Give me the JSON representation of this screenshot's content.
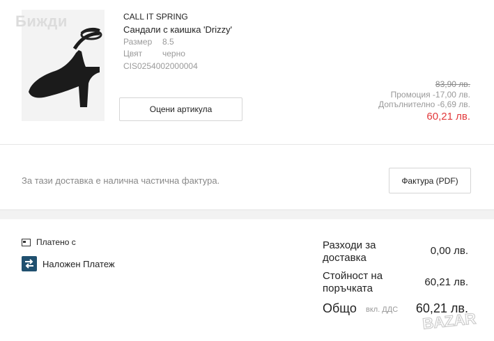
{
  "watermark": "Бижди",
  "item": {
    "brand": "CALL IT SPRING",
    "name": "Сандали с каишка 'Drizzy'",
    "size_label": "Размер",
    "size_value": "8.5",
    "color_label": "Цвят",
    "color_value": "черно",
    "sku": "CIS0254002000004",
    "rate_button": "Оцени артикула",
    "old_price": "83,90 лв.",
    "promotion": "Промоция -17,00 лв.",
    "additional": "Допълнително -6,69 лв.",
    "final_price": "60,21 лв.",
    "accent_color": "#e2393b"
  },
  "invoice": {
    "text": "За тази доставка е налична частична фактура.",
    "button": "Фактура (PDF)"
  },
  "payment": {
    "paid_with_label": "Платено с",
    "paid_icon": "card-icon",
    "method": "Наложен Платеж",
    "method_icon": "cash-on-delivery-icon"
  },
  "summary": {
    "shipping_label": "Разходи за доставка",
    "shipping_value": "0,00 лв.",
    "order_label": "Стойност на поръчката",
    "order_value": "60,21 лв.",
    "total_label": "Общо",
    "vat_label": "вкл. ДДС",
    "total_value": "60,21 лв."
  },
  "logo_text": "BAZAR"
}
